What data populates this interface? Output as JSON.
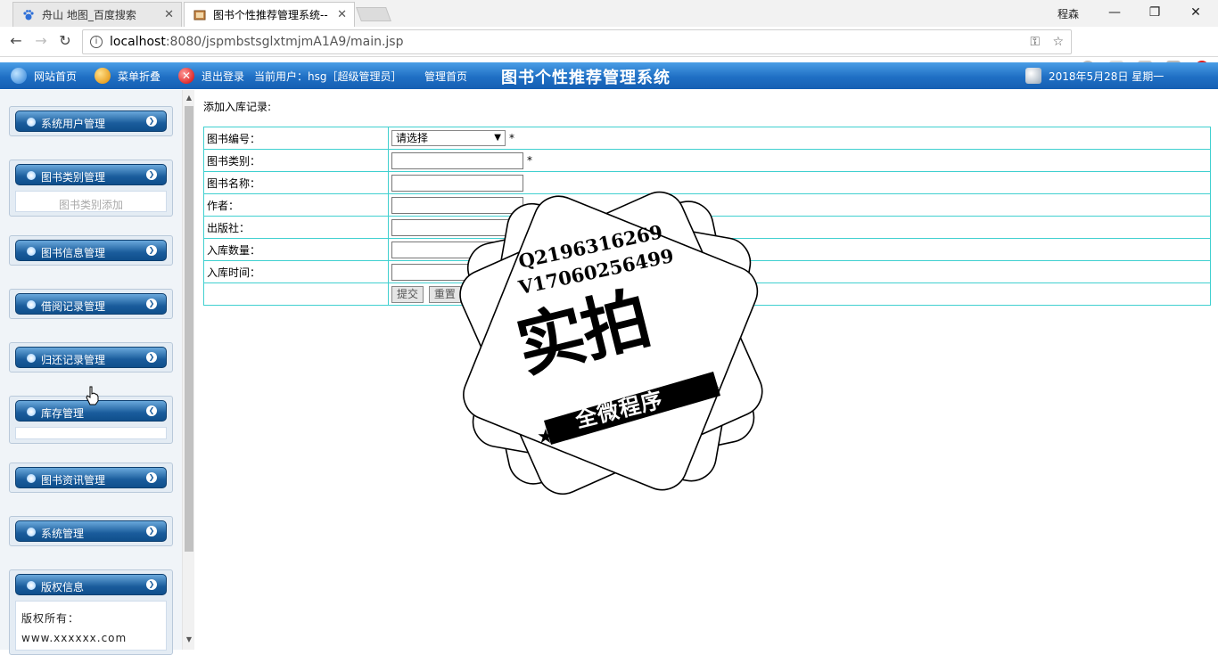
{
  "browser": {
    "tabs": [
      {
        "title": "舟山 地图_百度搜索",
        "active": false
      },
      {
        "title": "图书个性推荐管理系统--",
        "active": true
      }
    ],
    "profile_name": "程森",
    "url_host": "localhost",
    "url_rest": ":8080/jspmbstsglxtmjmA1A9/main.jsp"
  },
  "header": {
    "home_link": "网站首页",
    "collapse_menu": "菜单折叠",
    "logout": "退出登录",
    "current_user": "当前用户：hsg［超级管理员］",
    "admin_home": "管理首页",
    "system_title": "图书个性推荐管理系统",
    "date": "2018年5月28日 星期一"
  },
  "sidebar": {
    "menus": [
      {
        "label": "系统用户管理"
      },
      {
        "label": "图书类别管理",
        "submenu": "图书类别添加"
      },
      {
        "label": "图书信息管理"
      },
      {
        "label": "借阅记录管理"
      },
      {
        "label": "归还记录管理"
      },
      {
        "label": "库存管理"
      },
      {
        "label": "图书资讯管理"
      },
      {
        "label": "系统管理"
      },
      {
        "label": "版权信息"
      }
    ],
    "copyright_label": "版权所有：",
    "copyright_site": "www.xxxxxx.com"
  },
  "main": {
    "caption": "添加入库记录:",
    "fields": [
      {
        "label": "图书编号：",
        "type": "select",
        "value": "请选择",
        "required": "*"
      },
      {
        "label": "图书类别：",
        "type": "text",
        "value": "",
        "required": "*"
      },
      {
        "label": "图书名称：",
        "type": "text",
        "value": ""
      },
      {
        "label": "作者：",
        "type": "text",
        "value": ""
      },
      {
        "label": "出版社：",
        "type": "text",
        "value": ""
      },
      {
        "label": "入库数量：",
        "type": "text",
        "value": ""
      },
      {
        "label": "入库时间：",
        "type": "text",
        "value": ""
      }
    ],
    "submit_label": "提交",
    "reset_label": "重置"
  },
  "watermark": {
    "line1": "Q2196316269",
    "line2": "V17060256499",
    "big": "实拍",
    "sub": "全微程序"
  },
  "colors": {
    "header_blue": "#1f6fc4",
    "form_border": "#40d0d0",
    "menu_blue": "#1a5c9c"
  }
}
